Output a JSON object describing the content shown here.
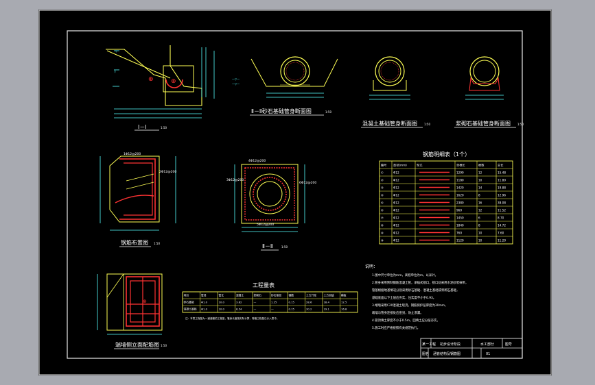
{
  "views": {
    "section_1": {
      "title": "Ⅰ－Ⅰ",
      "scale": "1:50"
    },
    "section_2": {
      "title": "Ⅱ－Ⅱ砂石基础管身断面图",
      "scale": "1:50"
    },
    "section_3": {
      "title": "混凝土基础管身断面图",
      "scale": "1:50"
    },
    "section_4": {
      "title": "浆砌石基础管身断面图",
      "scale": "1:50"
    },
    "rebar_side": {
      "title": "钢筋布置图",
      "scale": "1:50"
    },
    "rebar_front": {
      "title": "Ⅱ－Ⅱ",
      "scale": "1:50"
    },
    "rebar_wall": {
      "title": "端墙侧立面配筋图",
      "scale": "1:50"
    }
  },
  "rebar_labels": {
    "side_top": "1Φ12@200",
    "side_right": "2Φ12@200",
    "front_left": "3Φ12@200",
    "front_top": "4Φ12@200",
    "front_bottom": "5Φ12@200",
    "front_right": "6Φ12@200"
  },
  "rebar_table": {
    "title": "钢筋明细表（1个）",
    "headers": [
      "编号",
      "直径(mm)",
      "型式",
      "单根长",
      "根数",
      "总长"
    ],
    "rows": [
      [
        "①",
        "Φ12",
        "",
        "1290",
        "12",
        "15.48"
      ],
      [
        "②",
        "Φ12",
        "",
        "1180",
        "10",
        "11.80"
      ],
      [
        "③",
        "Φ12",
        "",
        "1420",
        "14",
        "19.88"
      ],
      [
        "④",
        "Φ12",
        "",
        "1620",
        "8",
        "12.96"
      ],
      [
        "⑤",
        "Φ12",
        "",
        "2380",
        "16",
        "38.08"
      ],
      [
        "⑥",
        "Φ12",
        "",
        "960",
        "12",
        "11.52"
      ],
      [
        "⑦",
        "Φ12",
        "",
        "1450",
        "6",
        "8.70"
      ],
      [
        "⑧",
        "Φ12",
        "",
        "1840",
        "8",
        "14.72"
      ],
      [
        "⑨",
        "Φ12",
        "",
        "760",
        "10",
        "7.60"
      ],
      [
        "⑩",
        "Φ12",
        "",
        "1120",
        "10",
        "11.20"
      ]
    ]
  },
  "quantity_table": {
    "title": "工程量表",
    "headers": [
      "项目",
      "管径",
      "管长",
      "混凝土",
      "浆砌石",
      "砂石垫层",
      "钢筋",
      "土方开挖",
      "土方回填",
      "模板"
    ],
    "rows": [
      [
        "砂石基础",
        "Φ1.0",
        "10.0",
        "3.82",
        "—",
        "1.25",
        "0.15",
        "28.6",
        "18.4",
        "12.5"
      ],
      [
        "混凝土基础",
        "Φ1.0",
        "10.0",
        "6.54",
        "—",
        "—",
        "0.15",
        "30.2",
        "19.1",
        "16.8"
      ]
    ],
    "note": "注：本表工程量为一道涵管的工程量，管身长度按实际计算，端墙工程量已计入表中。"
  },
  "notes": {
    "heading": "说明：",
    "lines": [
      "1.图中尺寸单位为mm，高程单位为m，以米计。",
      "2.管身采用预制钢筋混凝土管，承插式接口，接口处采用水泥砂浆抹带，",
      "  管基根据地基情况分别采用砂石基础、混凝土基础或浆砌石基础，",
      "  基础底面以下土层应夯实，压实度不小于0.93。",
      "3.端墙采用C20混凝土现浇，钢筋保护层厚度为30mm，",
      "  端墙与管身连接处应密封，防止渗漏。",
      "4.管顶填土厚度不小于0.5m，回填土应分层夯实。",
      "5.施工时应严格按照有关规范执行。"
    ]
  },
  "title_block": {
    "project": "某一工程",
    "stage": "初步设计阶段",
    "discipline": "水工部分",
    "sheet_label": "图号",
    "drawing_name": "涵管结构及钢筋图",
    "drawing_label": "图名",
    "sheet_no": "01"
  }
}
